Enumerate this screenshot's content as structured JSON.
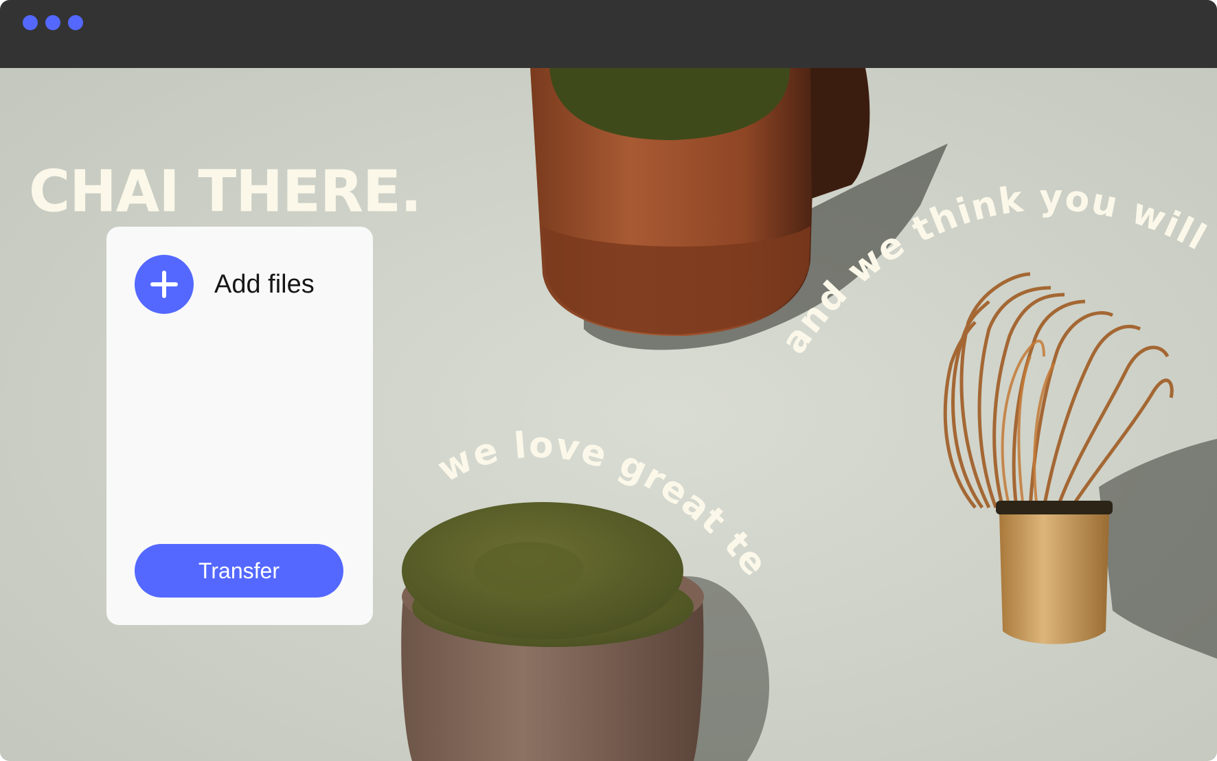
{
  "window": {
    "titlebar_color": "#333333",
    "traffic_light_color": "#5468ff",
    "traffic_lights": [
      "window-dot",
      "window-dot",
      "window-dot"
    ]
  },
  "hero": {
    "headline": "CHAI THERE.",
    "headline_color": "#fbf8ea",
    "tagline_top": "we love great tea",
    "tagline_right": "and we think you will too",
    "tagline_color": "#fbf8ea"
  },
  "upload_panel": {
    "add_files_label": "Add files",
    "add_icon": "plus-icon",
    "transfer_label": "Transfer",
    "accent_color": "#5468ff"
  }
}
